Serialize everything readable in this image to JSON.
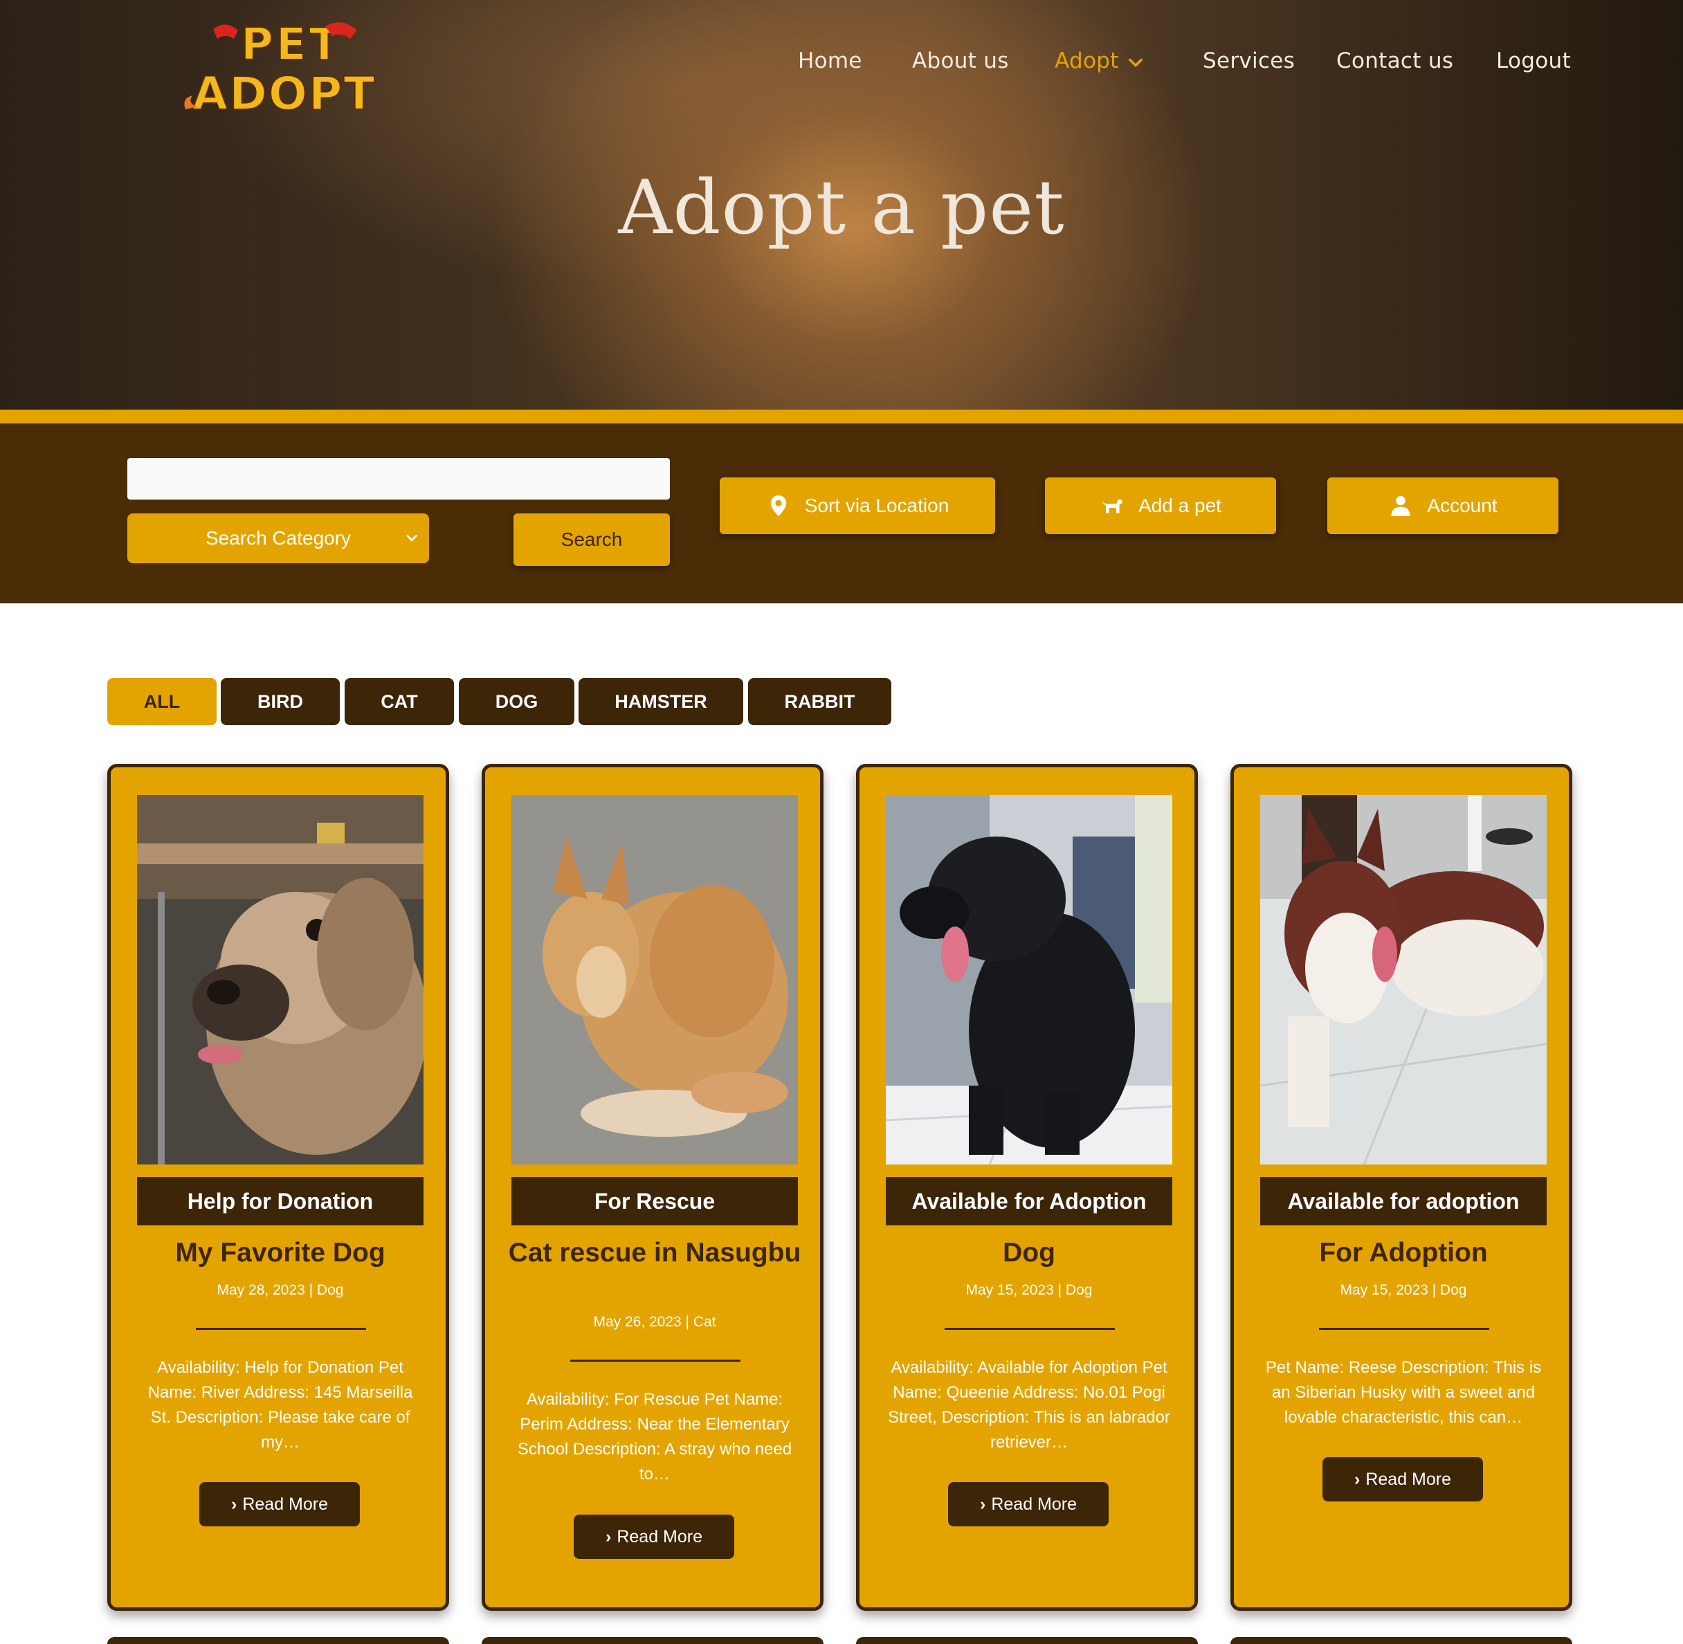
{
  "brand": {
    "logo_line1": "PET",
    "logo_line2": "ADOPT"
  },
  "nav": {
    "items": [
      "Home",
      "About us",
      "Adopt",
      "Services",
      "Contact us",
      "Logout"
    ],
    "active": "Adopt"
  },
  "hero": {
    "title": "Adopt a pet"
  },
  "toolbar": {
    "search_value": "",
    "category_label": "Search Category",
    "search_button": "Search",
    "sort_button": "Sort via Location",
    "add_button": "Add a pet",
    "account_button": "Account"
  },
  "filters": {
    "tabs": [
      "ALL",
      "BIRD",
      "CAT",
      "DOG",
      "HAMSTER",
      "RABBIT"
    ],
    "active": "ALL"
  },
  "cards": [
    {
      "status": "Help for Donation",
      "title": "My Favorite Dog",
      "meta": "May 28, 2023 | Dog",
      "description": "Availability: Help for Donation Pet Name: River Address: 145 Marseilla St. Description: Please take care of my…",
      "button": "Read More"
    },
    {
      "status": "For Rescue",
      "title": "Cat rescue in Nasugbu",
      "meta": "May 26, 2023 | Cat",
      "description": "Availability: For Rescue Pet Name: Perim Address: Near the Elementary School Description: A stray who need to…",
      "button": "Read More"
    },
    {
      "status": "Available for Adoption",
      "title": "Dog",
      "meta": "May 15, 2023 | Dog",
      "description": "Availability: Available for Adoption Pet Name: Queenie Address: No.01 Pogi Street, Description: This is an labrador retriever…",
      "button": "Read More"
    },
    {
      "status": "Available for adoption",
      "title": "For Adoption",
      "meta": "May 15, 2023 | Dog",
      "description": "Pet Name: Reese Description: This is an Siberian Husky with a sweet and lovable characteristic, this can…",
      "button": "Read More"
    }
  ],
  "colors": {
    "gold": "#e4a400",
    "dark_brown": "#3d2508",
    "toolbar_brown": "#4a2c07"
  }
}
